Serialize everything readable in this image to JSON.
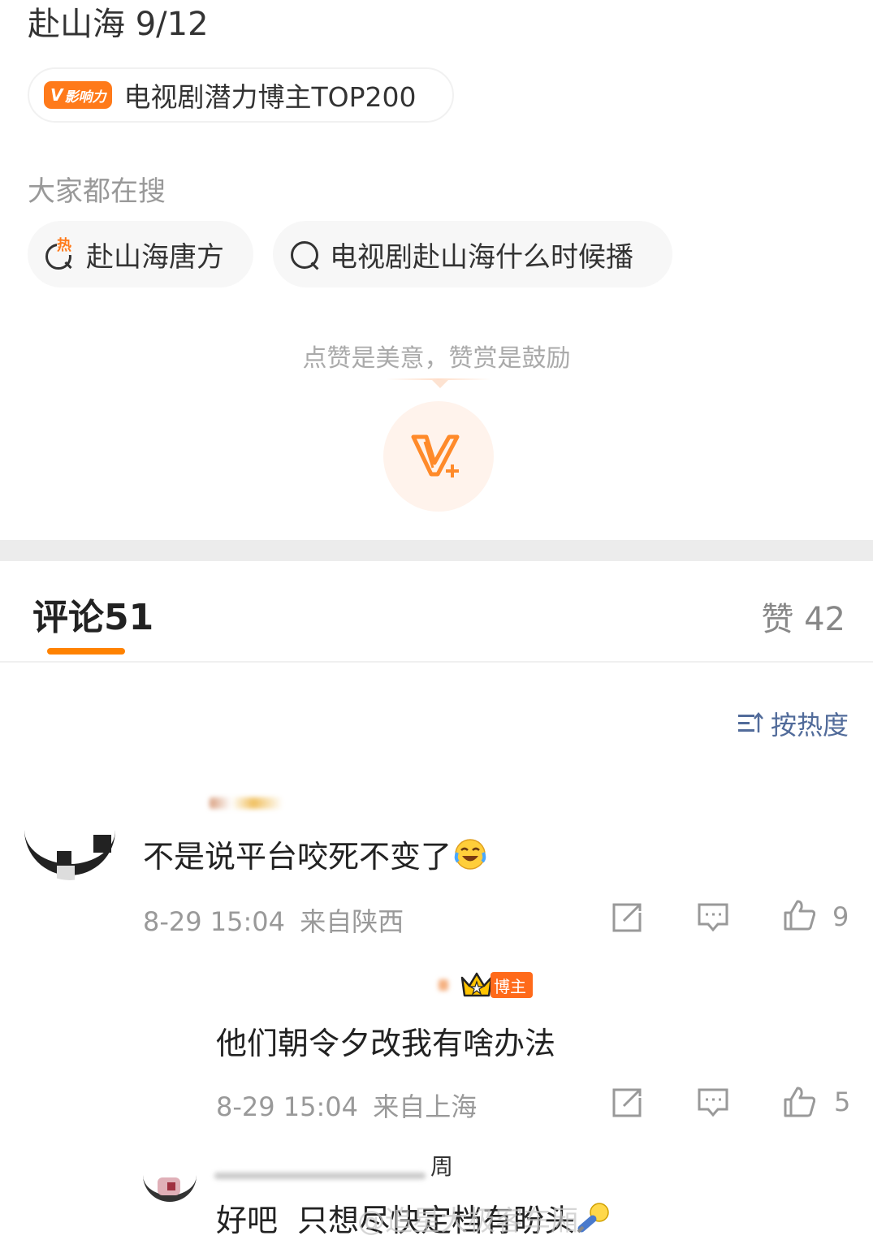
{
  "post": {
    "title": "赴山海 9/12",
    "badge": {
      "logo": "影响力",
      "logo_mark": "V",
      "text": "电视剧潜力博主TOP200"
    }
  },
  "search": {
    "label": "大家都在搜",
    "hot_mark": "热",
    "items": [
      "赴山海唐方",
      "电视剧赴山海什么时候播"
    ]
  },
  "reward": {
    "text": "点赞是美意，赞赏是鼓励"
  },
  "tabs": {
    "comments_label": "评论",
    "comments_count": "51",
    "likes_label": "赞",
    "likes_count": "42"
  },
  "sort": {
    "label": "按热度"
  },
  "comments": [
    {
      "text": "不是说平台咬死不变了",
      "emoji": "laugh-cry-emoji",
      "time": "8-29 15:04",
      "location": "来自陕西",
      "likes": "9"
    },
    {
      "tag": "博主",
      "text": "他们朝令夕改我有啥办法",
      "time": "8-29 15:04",
      "location": "来自上海",
      "likes": "5"
    },
    {
      "name_fragment": "周",
      "text": "好吧  只想尽快定档有盼头",
      "watermark": "@追星大极客车厢"
    }
  ],
  "colors": {
    "accent": "#ff8200",
    "link": "#516b9a",
    "meta": "#999999"
  }
}
